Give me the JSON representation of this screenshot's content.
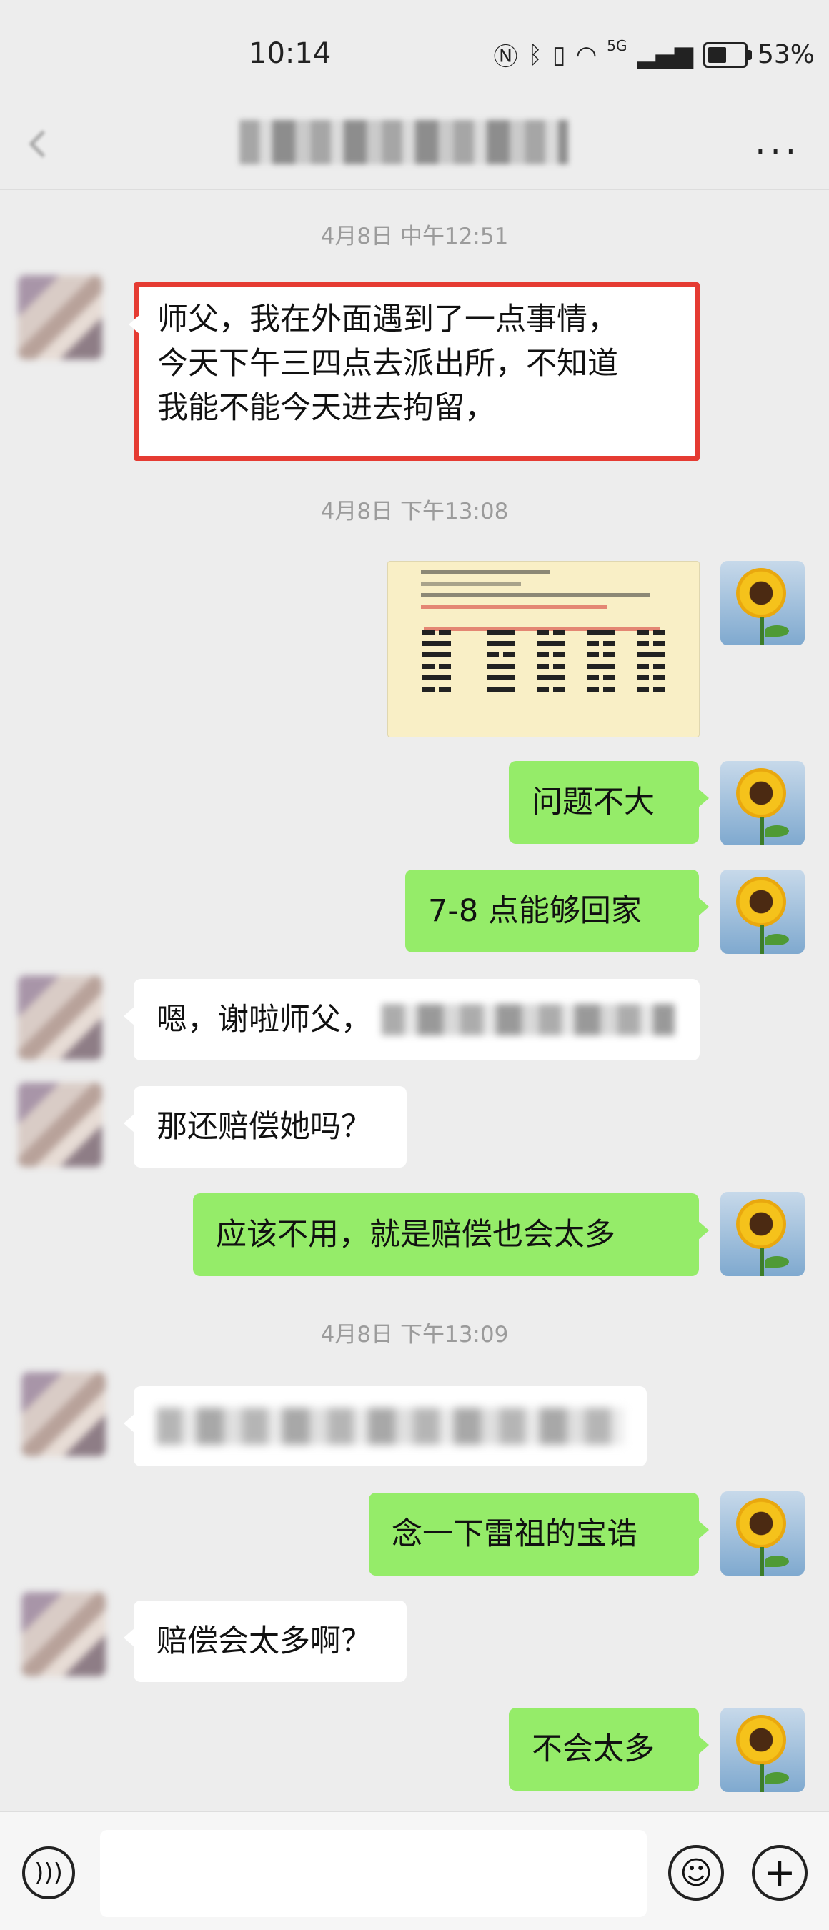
{
  "status_bar": {
    "time": "10:14",
    "network": "5G",
    "battery": "53%"
  },
  "header": {
    "more_label": "···"
  },
  "timestamps": [
    "4月8日 中午12:51",
    "4月8日 下午13:08",
    "4月8日 下午13:09"
  ],
  "messages": {
    "m1_line1": "师父，我在外面遇到了一点事情，",
    "m1_line2": "今天下午三四点去派出所，不知道",
    "m1_line3": "我能不能今天进去拘留，",
    "m3": "问题不大",
    "m4": "7-8 点能够回家",
    "m5": "嗯，谢啦师父，",
    "m6": "那还赔偿她吗？",
    "m7": "应该不用，就是赔偿也会太多",
    "m9": "念一下雷祖的宝诰",
    "m10": "赔偿会太多啊？",
    "m11": "不会太多"
  },
  "input_bar": {
    "voice_icon": "voice-icon",
    "emoji_icon": "emoji-icon",
    "plus_icon": "plus-icon"
  },
  "colors": {
    "background": "#ededed",
    "sent_bubble": "#95ec69",
    "received_bubble": "#ffffff",
    "highlight_border": "#e53b32"
  }
}
